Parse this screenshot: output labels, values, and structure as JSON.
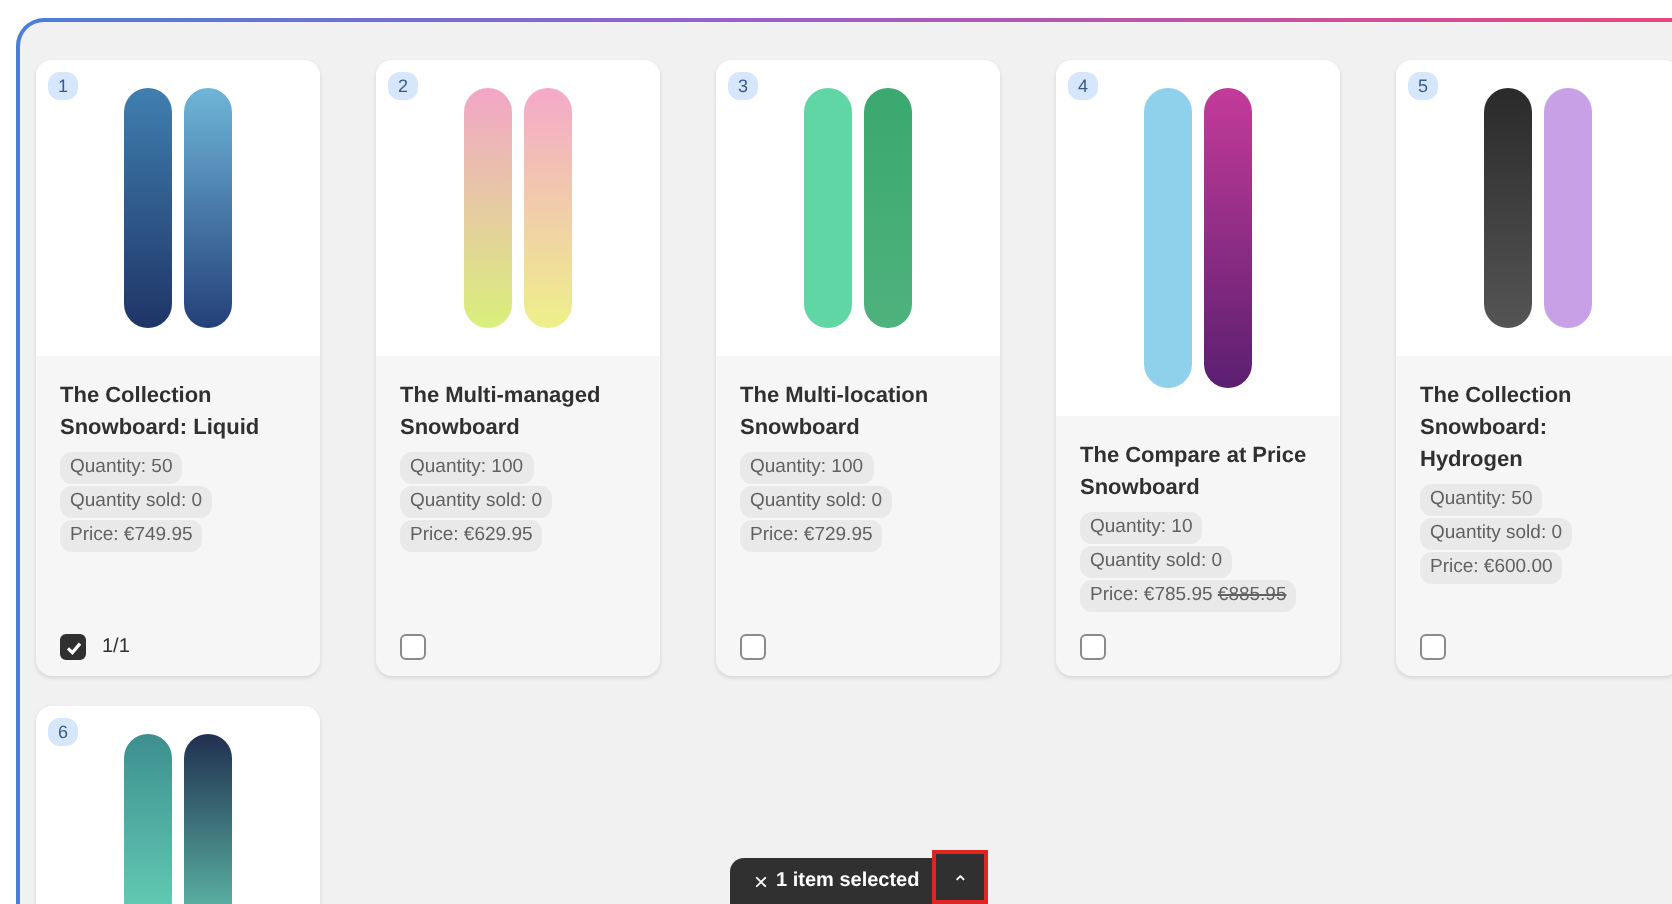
{
  "products": [
    {
      "number": "1",
      "title": "The Collection Snowboard: Liquid",
      "quantity": "Quantity: 50",
      "sold": "Quantity sold: 0",
      "price": "Price: €749.95",
      "checked": true,
      "count": "1/1"
    },
    {
      "number": "2",
      "title": "The Multi-managed Snowboard",
      "quantity": "Quantity: 100",
      "sold": "Quantity sold: 0",
      "price": "Price: €629.95",
      "checked": false
    },
    {
      "number": "3",
      "title": "The Multi-location Snowboard",
      "quantity": "Quantity: 100",
      "sold": "Quantity sold: 0",
      "price": "Price: €729.95",
      "checked": false
    },
    {
      "number": "4",
      "title": "The Compare at Price Snowboard",
      "quantity": "Quantity: 10",
      "sold": "Quantity sold: 0",
      "price": "Price: €785.95",
      "compare_price": "€885.95",
      "checked": false
    },
    {
      "number": "5",
      "title": "The Collection Snowboard: Hydrogen",
      "quantity": "Quantity: 50",
      "sold": "Quantity sold: 0",
      "price": "Price: €600.00",
      "checked": false
    },
    {
      "number": "6"
    }
  ],
  "selection_bar": {
    "close": "×",
    "label": "1 item selected",
    "expand": "⌃",
    "highlighted": true
  }
}
